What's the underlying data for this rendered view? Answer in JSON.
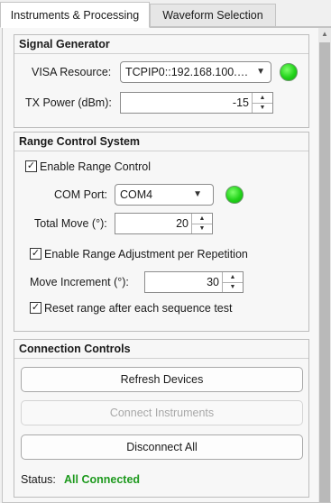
{
  "tabs": [
    "Instruments & Processing",
    "Waveform Selection"
  ],
  "signal_generator": {
    "title": "Signal Generator",
    "visa_label": "VISA Resource:",
    "visa_value": "TCPIP0::192.168.100.…",
    "tx_label": "TX Power (dBm):",
    "tx_value": "-15"
  },
  "range_control": {
    "title": "Range Control System",
    "enable_label": "Enable Range Control",
    "com_label": "COM Port:",
    "com_value": "COM4",
    "total_move_label": "Total Move (°):",
    "total_move_value": "20",
    "enable_adjust_label": "Enable Range Adjustment per Repetition",
    "move_increment_label": "Move Increment (°):",
    "move_increment_value": "30",
    "reset_label": "Reset range after each sequence test"
  },
  "connection": {
    "title": "Connection Controls",
    "refresh_label": "Refresh Devices",
    "connect_label": "Connect Instruments",
    "disconnect_label": "Disconnect All",
    "status_label": "Status:",
    "status_value": "All Connected"
  },
  "icons": {
    "check": "✓",
    "dropdown_arrow": "▼",
    "spin_up": "▲",
    "spin_down": "▼",
    "scroll_up": "▲"
  },
  "colors": {
    "lamp_green": "#22d31a",
    "status_green": "#1e9a1e"
  }
}
